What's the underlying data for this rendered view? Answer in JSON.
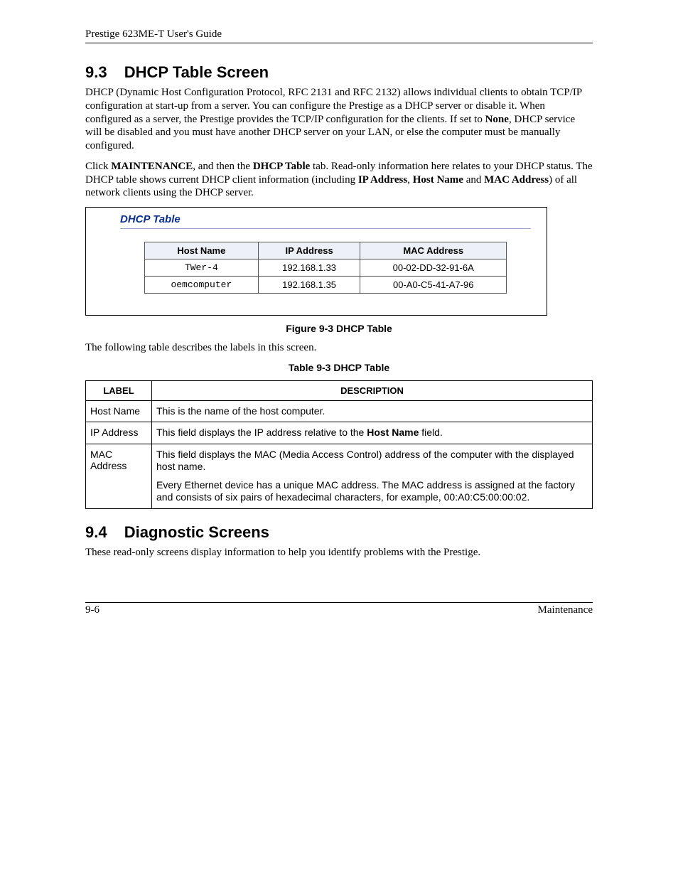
{
  "header": {
    "guide": "Prestige 623ME-T User's Guide"
  },
  "sec93": {
    "num": "9.3",
    "title": "DHCP Table Screen",
    "p1_a": "DHCP (Dynamic Host Configuration Protocol, RFC 2131 and RFC 2132) allows individual clients to obtain TCP/IP configuration at start-up from a server. You can configure the Prestige as a DHCP server or disable it. When configured as a server, the Prestige provides the TCP/IP configuration for the clients. If set to ",
    "p1_none": "None",
    "p1_b": ", DHCP service will be disabled and you must have another DHCP server on your LAN, or else the computer must be manually configured.",
    "p2_a": "Click ",
    "p2_maint": "MAINTENANCE",
    "p2_b": ", and then the ",
    "p2_tab": "DHCP Table",
    "p2_c": " tab. Read-only information here relates to your DHCP status. The DHCP table shows current DHCP client information (including ",
    "p2_ip": "IP Address",
    "p2_d": ", ",
    "p2_hn": "Host Name",
    "p2_e": " and ",
    "p2_mac": "MAC Address",
    "p2_f": ") of all network clients using the DHCP server."
  },
  "dhcp_panel": {
    "title": "DHCP Table",
    "headers": {
      "host": "Host Name",
      "ip": "IP Address",
      "mac": "MAC Address"
    },
    "rows": [
      {
        "host": "TWer-4",
        "ip": "192.168.1.33",
        "mac": "00-02-DD-32-91-6A"
      },
      {
        "host": "oemcomputer",
        "ip": "192.168.1.35",
        "mac": "00-A0-C5-41-A7-96"
      }
    ]
  },
  "figcap": "Figure 9-3 DHCP Table",
  "mid_sentence": "The following table describes the labels in this screen.",
  "tabcap": "Table 9-3 DHCP Table",
  "desc_table": {
    "h_label": "LABEL",
    "h_desc": "DESCRIPTION",
    "rows": [
      {
        "label": "Host Name",
        "p1": "This is the name of the host computer."
      },
      {
        "label": "IP Address",
        "p1_a": "This field displays the IP address relative to the ",
        "p1_bold": "Host Name",
        "p1_b": " field."
      },
      {
        "label": "MAC Address",
        "p1": "This field displays the MAC (Media Access Control) address of the computer with the displayed host name.",
        "p2": "Every Ethernet device has a unique MAC address. The MAC address is assigned at the factory and consists of six pairs of hexadecimal characters, for example, 00:A0:C5:00:00:02."
      }
    ]
  },
  "sec94": {
    "num": "9.4",
    "title": "Diagnostic Screens",
    "p1": "These read-only screens display information to help you identify problems with the Prestige."
  },
  "footer": {
    "left": "9-6",
    "right": "Maintenance"
  }
}
